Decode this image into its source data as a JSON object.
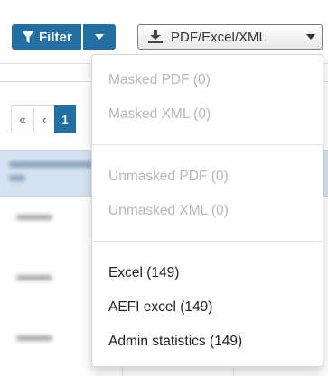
{
  "toolbar": {
    "filter_label": "Filter",
    "export_label": "PDF/Excel/XML"
  },
  "pagination": {
    "first": "«",
    "prev": "‹",
    "current": "1"
  },
  "dropdown": {
    "groups": [
      {
        "items": [
          {
            "label": "Masked PDF (0)",
            "enabled": false
          },
          {
            "label": "Masked XML (0)",
            "enabled": false
          }
        ]
      },
      {
        "items": [
          {
            "label": "Unmasked PDF (0)",
            "enabled": false
          },
          {
            "label": "Unmasked XML (0)",
            "enabled": false
          }
        ]
      },
      {
        "items": [
          {
            "label": "Excel (149)",
            "enabled": true
          },
          {
            "label": "AEFI excel (149)",
            "enabled": true
          },
          {
            "label": "Admin statistics (149)",
            "enabled": true
          }
        ]
      }
    ]
  },
  "icons": {
    "filter": "funnel-icon",
    "caret": "caret-down-icon",
    "export": "download-icon"
  },
  "colors": {
    "primary": "#236fa1",
    "disabled_text": "#b8b8b8",
    "table_header": "#d5e3f0"
  }
}
